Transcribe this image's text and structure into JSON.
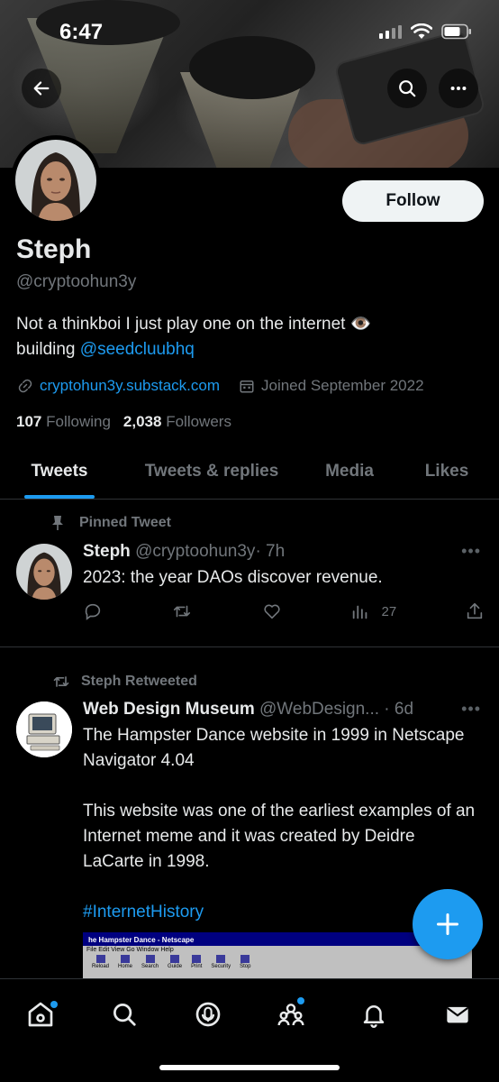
{
  "status_bar": {
    "time": "6:47"
  },
  "profile": {
    "name": "Steph",
    "handle": "@cryptoohun3y",
    "bio_text": "Not a thinkboi I just play one on the internet 👁️",
    "bio_line2_prefix": "building ",
    "bio_mention": "@seedcluubhq",
    "website": "cryptohun3y.substack.com",
    "joined": "Joined September 2022",
    "following_count": "107",
    "following_label": "Following",
    "followers_count": "2,038",
    "followers_label": "Followers",
    "follow_button": "Follow"
  },
  "tabs": [
    {
      "label": "Tweets",
      "active": true
    },
    {
      "label": "Tweets & replies"
    },
    {
      "label": "Media"
    },
    {
      "label": "Likes"
    }
  ],
  "tweets": [
    {
      "context": "Pinned Tweet",
      "author": "Steph",
      "handle": "@cryptoohun3y",
      "time": "· 7h",
      "text": "2023: the year DAOs discover revenue.",
      "views": "27"
    },
    {
      "context": "Steph Retweeted",
      "author": "Web Design Museum",
      "handle": "@WebDesign...",
      "time": "· 6d",
      "text_1": "The Hampster Dance website in 1999 in Netscape Navigator 4.04",
      "text_2": "This website was one of the earliest examples of an Internet meme and it was created by Deidre LaCarte in 1998.",
      "hashtag": "#InternetHistory",
      "media": {
        "title": "he Hampster Dance - Netscape",
        "menu": "File  Edit  View  Go  Window  Help",
        "toolbar": [
          "Reload",
          "Home",
          "Search",
          "Guide",
          "Print",
          "Security",
          "Stop"
        ]
      }
    }
  ],
  "colors": {
    "accent": "#1d9bf0",
    "background": "#000000",
    "muted": "#71767b",
    "text": "#e7e9ea"
  }
}
